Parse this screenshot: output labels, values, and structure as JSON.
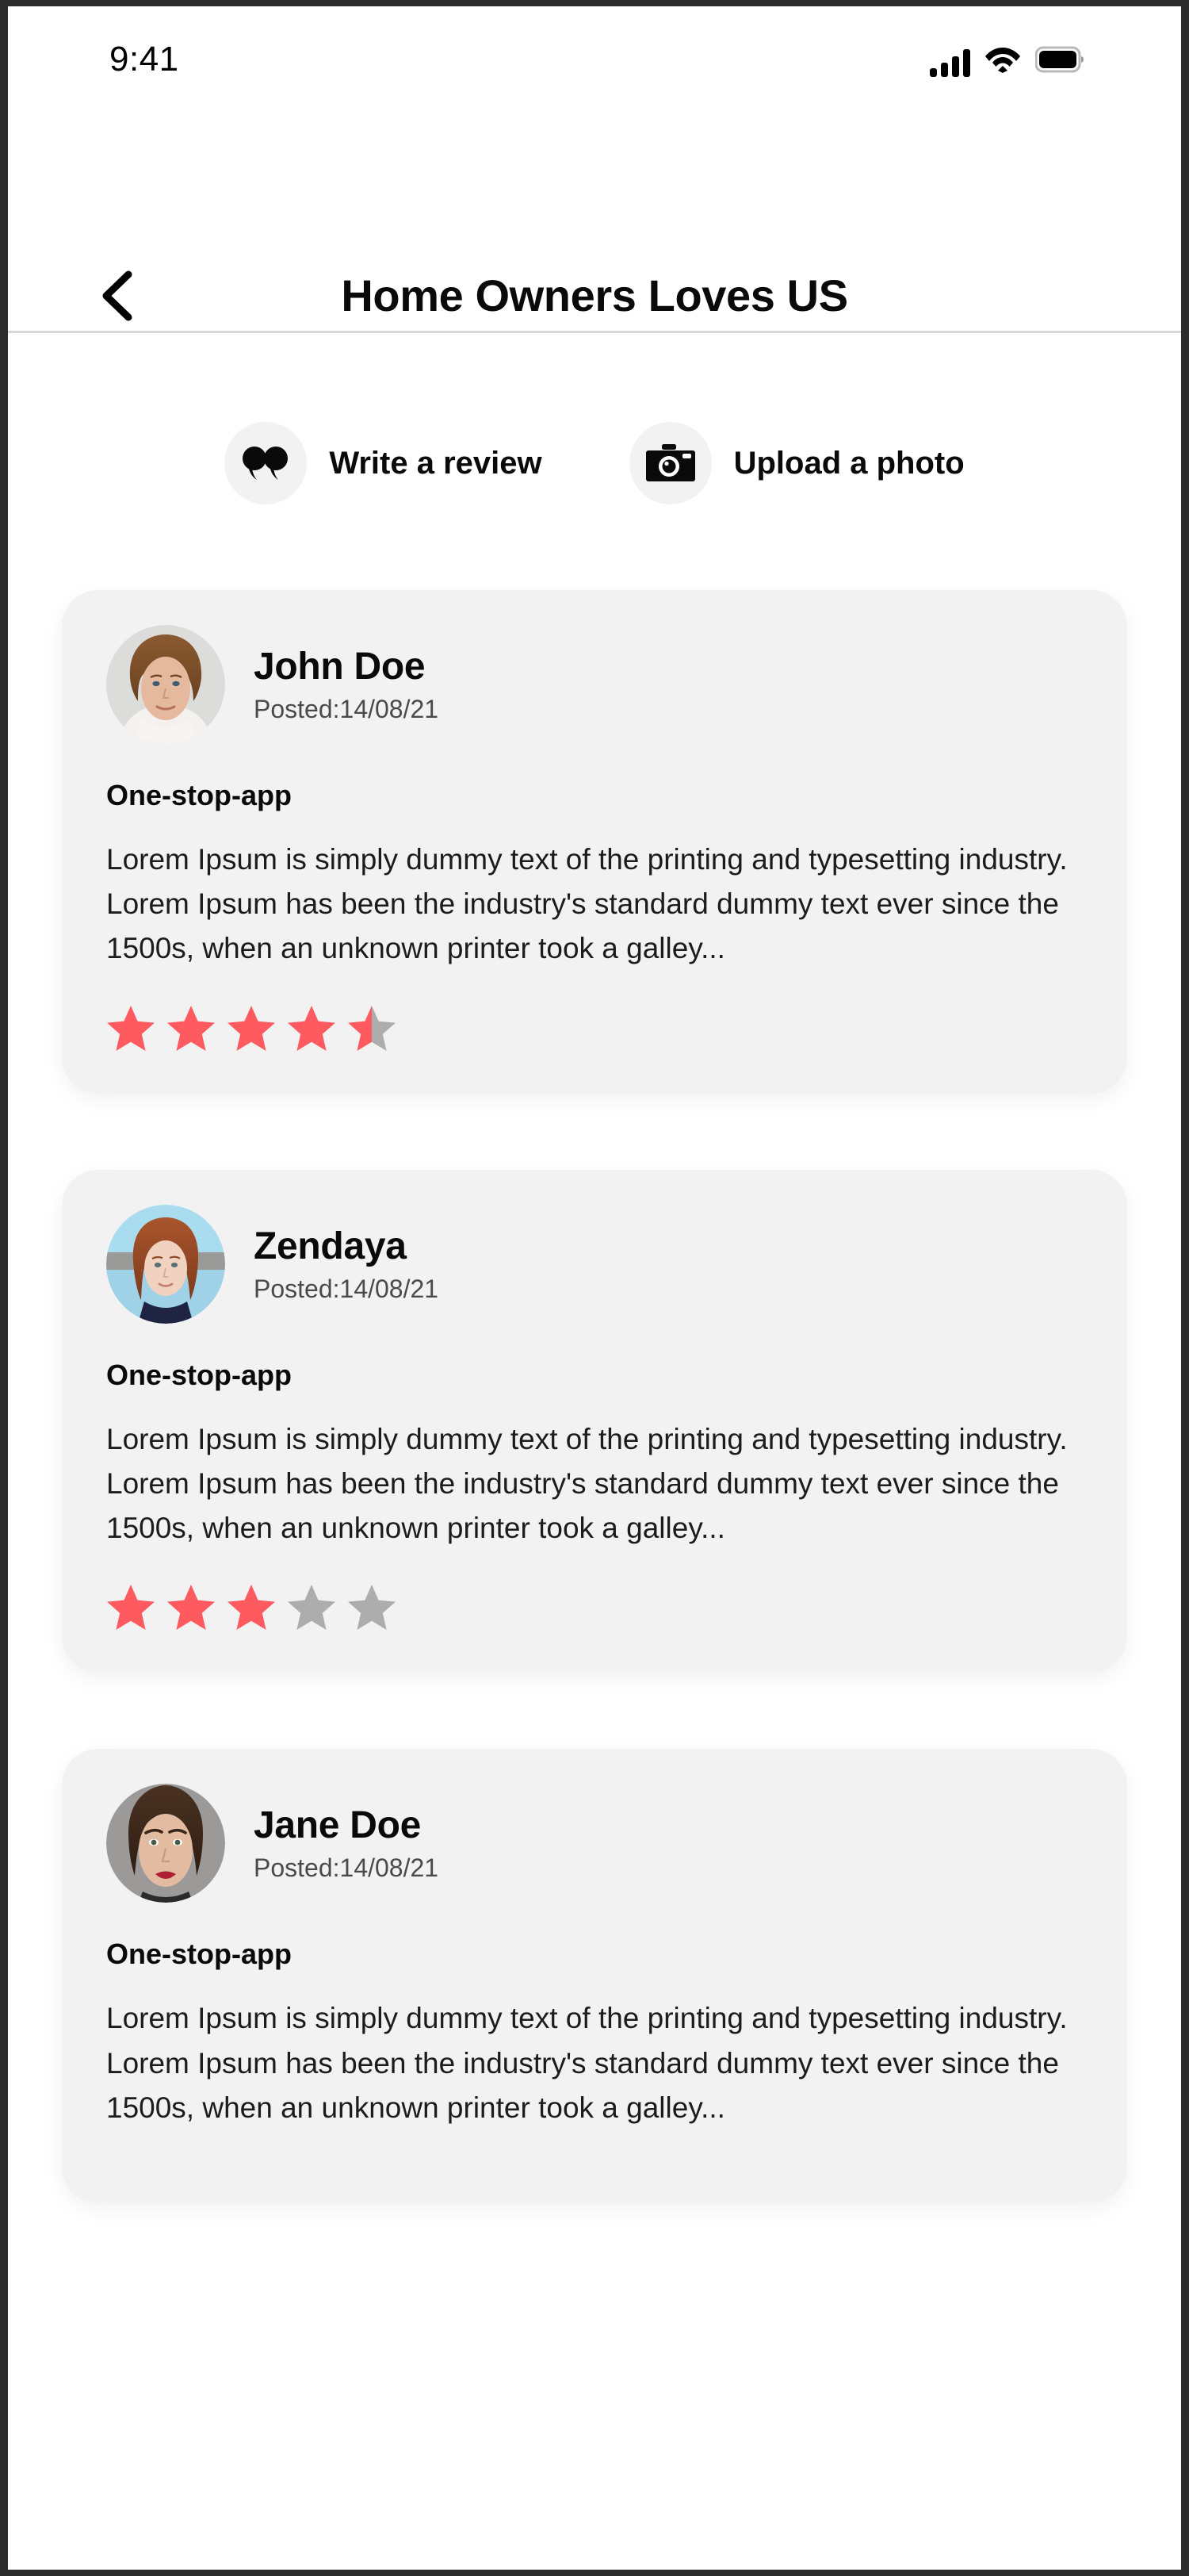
{
  "status_bar": {
    "time": "9:41",
    "signal_icon": "signal-bars-icon",
    "wifi_icon": "wifi-icon",
    "battery_icon": "battery-full-icon"
  },
  "header": {
    "back_icon": "chevron-left-icon",
    "title": "Home Owners Loves US"
  },
  "actions": [
    {
      "label": "Write a review",
      "icon": "quote-bubbles-icon"
    },
    {
      "label": "Upload a photo",
      "icon": "camera-icon"
    }
  ],
  "reviews": [
    {
      "name": "John Doe",
      "posted": "Posted:14/08/21",
      "subject": "One-stop-app",
      "body": "Lorem Ipsum is simply dummy text of the printing and typesetting industry. Lorem Ipsum has been the industry's standard dummy text ever since the 1500s, when an unknown printer took a galley...",
      "rating": 4.5,
      "avatar": "portrait-john-doe"
    },
    {
      "name": "Zendaya",
      "posted": "Posted:14/08/21",
      "subject": "One-stop-app",
      "body": "Lorem Ipsum is simply dummy text of the printing and typesetting industry. Lorem Ipsum has been the industry's standard dummy text ever since the 1500s, when an unknown printer took a galley...",
      "rating": 3,
      "avatar": "portrait-zendaya"
    },
    {
      "name": "Jane Doe",
      "posted": "Posted:14/08/21",
      "subject": "One-stop-app",
      "body": "Lorem Ipsum is simply dummy text of the printing and typesetting industry. Lorem Ipsum has been the industry's standard dummy text ever since the 1500s, when an unknown printer took a galley...",
      "rating": 0,
      "avatar": "portrait-jane-doe"
    }
  ],
  "colors": {
    "star_filled": "#FF5A5F",
    "star_empty": "#ADADAD",
    "card_background": "#F2F2F2",
    "screen_background": "#FFFFFF",
    "text_primary": "#0A0A0A"
  }
}
